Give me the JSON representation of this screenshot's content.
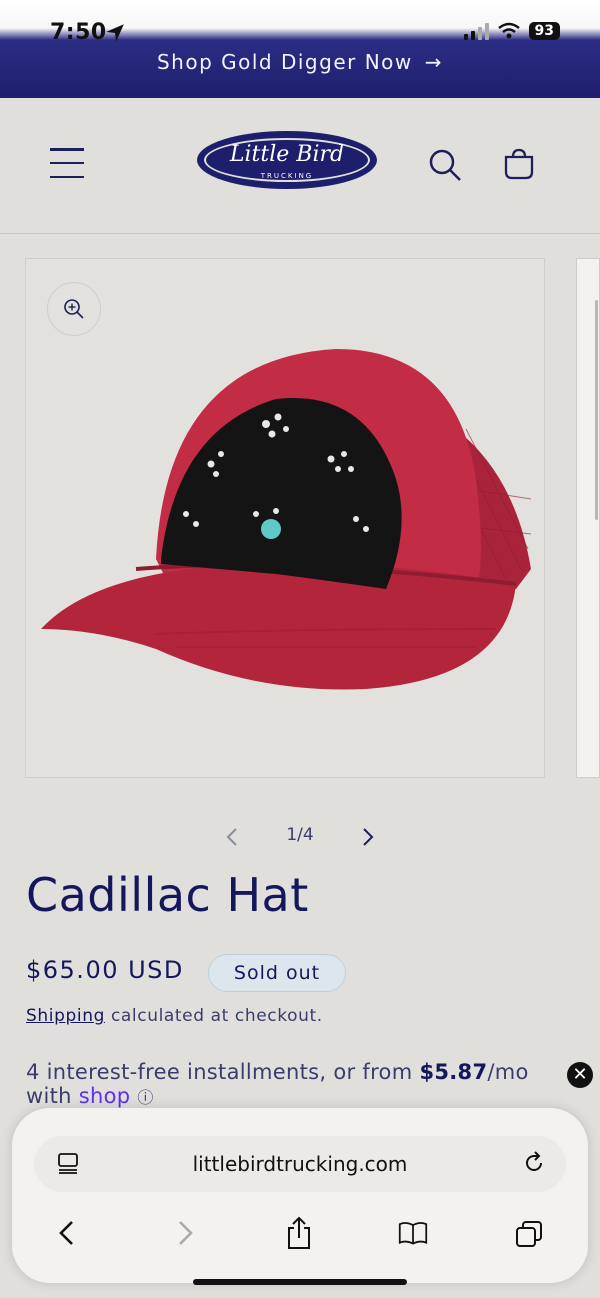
{
  "status_bar": {
    "time": "7:50",
    "battery": "93"
  },
  "announcement": {
    "text": "Shop Gold Digger Now",
    "arrow": "→"
  },
  "header": {
    "logo_script": "Little Bird",
    "logo_sub": "TRUCKING",
    "icons": [
      "menu-icon",
      "search-icon",
      "cart-icon"
    ]
  },
  "product": {
    "title": "Cadillac Hat",
    "price": "$65.00 USD",
    "badge": "Sold out",
    "shipping_link": "Shipping",
    "shipping_rest": " calculated at checkout.",
    "installments_prefix": "4 interest-free installments, or from ",
    "installments_amount": "$5.87",
    "installments_suffix": "/mo",
    "installments_line2": "with ",
    "shop_label": "shop",
    "pagination": "1/4"
  },
  "browser": {
    "url": "littlebirdtrucking.com",
    "toolbar": [
      "back-icon",
      "forward-icon",
      "share-icon",
      "bookmarks-icon",
      "tabs-icon"
    ]
  },
  "colors": {
    "navy": "#15175e",
    "banner": "#1d1f6d",
    "badge_bg": "#dce6ec",
    "hat": "#b8283f"
  }
}
